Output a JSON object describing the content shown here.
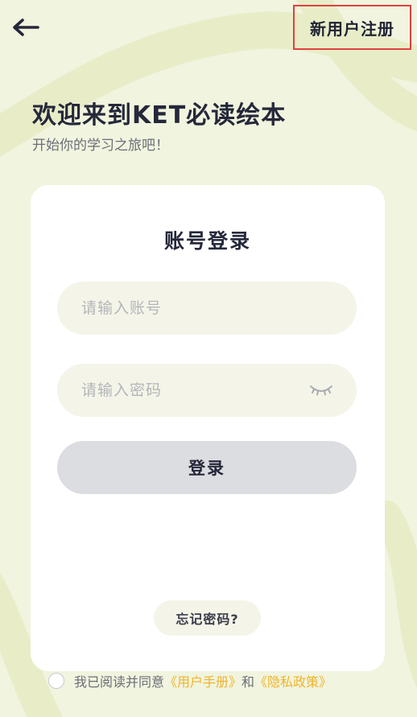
{
  "header": {
    "back_icon": "arrow-left-icon",
    "register_label": "新用户注册"
  },
  "welcome": {
    "title": "欢迎来到KET必读绘本",
    "subtitle": "开始你的学习之旅吧！"
  },
  "login_card": {
    "title": "账号登录",
    "account": {
      "value": "",
      "placeholder": "请输入账号"
    },
    "password": {
      "value": "",
      "placeholder": "请输入密码",
      "toggle_icon": "eye-closed-icon"
    },
    "login_label": "登录",
    "forgot_label": "忘记密码?"
  },
  "agreement": {
    "checked": false,
    "prefix": "我已阅读并同意",
    "user_manual": "《用户手册》",
    "and": "和",
    "privacy_policy": "《隐私政策》"
  },
  "colors": {
    "background": "#f1f4de",
    "highlight_border": "#e0413f",
    "link": "#f0b429",
    "login_button": "#dcdde0"
  }
}
